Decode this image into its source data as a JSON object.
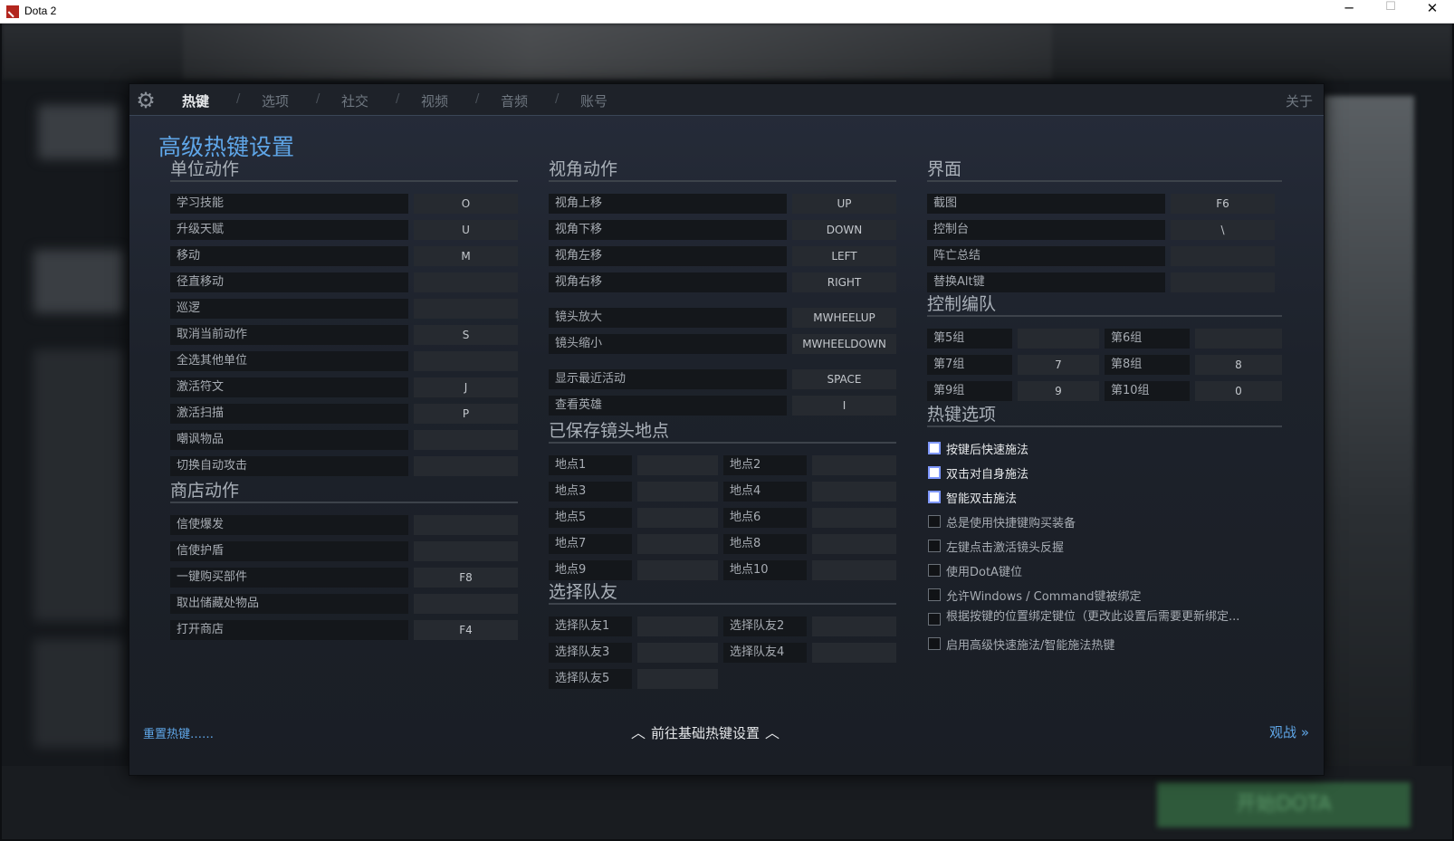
{
  "window": {
    "title": "Dota 2",
    "min": "─",
    "max": "☐",
    "close": "✕"
  },
  "background": {
    "play_button": "开始DOTA"
  },
  "nav": {
    "tabs": [
      "热键",
      "选项",
      "社交",
      "视频",
      "音频",
      "账号"
    ],
    "separator": "/",
    "about": "关于"
  },
  "page_title": "高级热键设置",
  "unit_actions": {
    "title": "单位动作",
    "rows": [
      {
        "label": "学习技能",
        "key": "O"
      },
      {
        "label": "升级天赋",
        "key": "U"
      },
      {
        "label": "移动",
        "key": "M"
      },
      {
        "label": "径直移动",
        "key": ""
      },
      {
        "label": "巡逻",
        "key": ""
      },
      {
        "label": "取消当前动作",
        "key": "S"
      },
      {
        "label": "全选其他单位",
        "key": ""
      },
      {
        "label": "激活符文",
        "key": "J"
      },
      {
        "label": "激活扫描",
        "key": "P"
      },
      {
        "label": "嘲讽物品",
        "key": ""
      },
      {
        "label": "切换自动攻击",
        "key": ""
      }
    ]
  },
  "shop_actions": {
    "title": "商店动作",
    "rows": [
      {
        "label": "信使爆发",
        "key": ""
      },
      {
        "label": "信使护盾",
        "key": ""
      },
      {
        "label": "一键购买部件",
        "key": "F8"
      },
      {
        "label": "取出储藏处物品",
        "key": ""
      },
      {
        "label": "打开商店",
        "key": "F4"
      }
    ]
  },
  "camera_actions": {
    "title": "视角动作",
    "rows": [
      {
        "label": "视角上移",
        "key": "UP"
      },
      {
        "label": "视角下移",
        "key": "DOWN"
      },
      {
        "label": "视角左移",
        "key": "LEFT"
      },
      {
        "label": "视角右移",
        "key": "RIGHT"
      },
      {
        "label": "镜头放大",
        "key": "MWHEELUP"
      },
      {
        "label": "镜头缩小",
        "key": "MWHEELDOWN"
      },
      {
        "label": "显示最近活动",
        "key": "SPACE"
      },
      {
        "label": "查看英雄",
        "key": "I"
      }
    ]
  },
  "saved_camera": {
    "title": "已保存镜头地点",
    "rows": [
      {
        "label": "地点1",
        "key": ""
      },
      {
        "label": "地点2",
        "key": ""
      },
      {
        "label": "地点3",
        "key": ""
      },
      {
        "label": "地点4",
        "key": ""
      },
      {
        "label": "地点5",
        "key": ""
      },
      {
        "label": "地点6",
        "key": ""
      },
      {
        "label": "地点7",
        "key": ""
      },
      {
        "label": "地点8",
        "key": ""
      },
      {
        "label": "地点9",
        "key": ""
      },
      {
        "label": "地点10",
        "key": ""
      }
    ]
  },
  "select_ally": {
    "title": "选择队友",
    "rows": [
      {
        "label": "选择队友1",
        "key": ""
      },
      {
        "label": "选择队友2",
        "key": ""
      },
      {
        "label": "选择队友3",
        "key": ""
      },
      {
        "label": "选择队友4",
        "key": ""
      },
      {
        "label": "选择队友5",
        "key": ""
      }
    ]
  },
  "interface": {
    "title": "界面",
    "rows": [
      {
        "label": "截图",
        "key": "F6"
      },
      {
        "label": "控制台",
        "key": "\\"
      },
      {
        "label": "阵亡总结",
        "key": ""
      },
      {
        "label": "替换Alt键",
        "key": ""
      }
    ]
  },
  "control_groups": {
    "title": "控制编队",
    "rows": [
      {
        "label": "第5组",
        "key": ""
      },
      {
        "label": "第6组",
        "key": ""
      },
      {
        "label": "第7组",
        "key": "7"
      },
      {
        "label": "第8组",
        "key": "8"
      },
      {
        "label": "第9组",
        "key": "9"
      },
      {
        "label": "第10组",
        "key": "0"
      }
    ]
  },
  "hotkey_options": {
    "title": "热键选项",
    "items": [
      {
        "label": "按键后快速施法",
        "checked": true
      },
      {
        "label": "双击对自身施法",
        "checked": true
      },
      {
        "label": "智能双击施法",
        "checked": true
      },
      {
        "label": "总是使用快捷键购买装备",
        "checked": false
      },
      {
        "label": "左键点击激活镜头反握",
        "checked": false
      },
      {
        "label": "使用DotA键位",
        "checked": false
      },
      {
        "label": "允许Windows / Command键被绑定",
        "checked": false
      },
      {
        "label": "根据按键的位置绑定键位（更改此设置后需要更新绑定...",
        "checked": false
      },
      {
        "label": "启用高级快速施法/智能施法热键",
        "checked": false
      }
    ]
  },
  "footer": {
    "reset": "重置热键……",
    "basic": "前往基础热键设置",
    "chevron": "︿",
    "watch": "观战",
    "watch_icon": "»"
  },
  "colors": {
    "accent": "#5fa6e8",
    "checkbox_border": "#7f98ff",
    "panel_bg": "#1d222b"
  }
}
